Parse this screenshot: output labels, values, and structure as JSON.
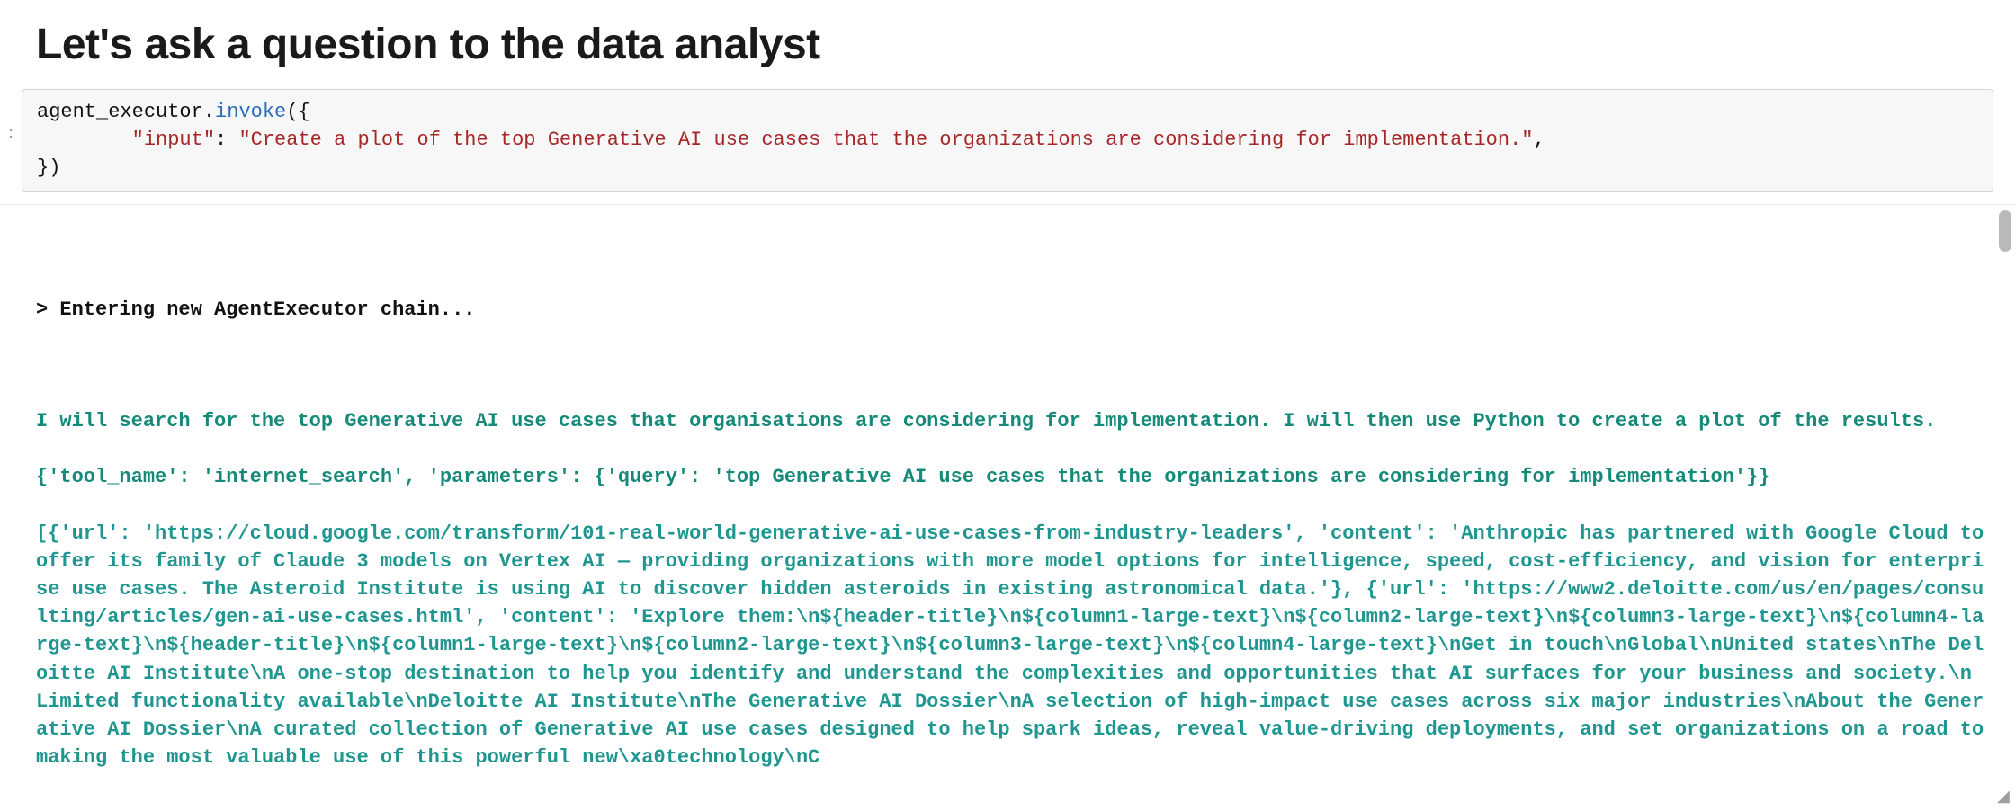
{
  "heading": "Let's ask a question to the data analyst",
  "gutter": ":",
  "code": {
    "line1_obj": "agent_executor",
    "line1_dot": ".",
    "line1_attr": "invoke",
    "line1_open": "({",
    "line2_indent": "        ",
    "line2_key": "\"input\"",
    "line2_colon": ": ",
    "line2_val": "\"Create a plot of the top Generative AI use cases that the organizations are considering for implementation.\"",
    "line2_comma": ",",
    "line3_close": "})"
  },
  "output": {
    "entering": "> Entering new AgentExecutor chain...",
    "thought": "I will search for the top Generative AI use cases that organisations are considering for implementation. I will then use Python to create a plot of the results.",
    "tool_call": "{'tool_name': 'internet_search', 'parameters': {'query': 'top Generative AI use cases that the organizations are considering for implementation'}}",
    "tool_result": "[{'url': 'https://cloud.google.com/transform/101-real-world-generative-ai-use-cases-from-industry-leaders', 'content': 'Anthropic has partnered with Google Cloud to offer its family of Claude 3 models on Vertex AI — providing organizations with more model options for intelligence, speed, cost-efficiency, and vision for enterprise use cases. The Asteroid Institute is using AI to discover hidden asteroids in existing astronomical data.'}, {'url': 'https://www2.deloitte.com/us/en/pages/consulting/articles/gen-ai-use-cases.html', 'content': 'Explore them:\\n${header-title}\\n${column1-large-text}\\n${column2-large-text}\\n${column3-large-text}\\n${column4-large-text}\\n${header-title}\\n${column1-large-text}\\n${column2-large-text}\\n${column3-large-text}\\n${column4-large-text}\\nGet in touch\\nGlobal\\nUnited states\\nThe Deloitte AI Institute\\nA one-stop destination to help you identify and understand the complexities and opportunities that AI surfaces for your business and society.\\n Limited functionality available\\nDeloitte AI Institute\\nThe Generative AI Dossier\\nA selection of high-impact use cases across six major industries\\nAbout the Generative AI Dossier\\nA curated collection of Generative AI use cases designed to help spark ideas, reveal value-driving deployments, and set organizations on a road to making the most valuable use of this powerful new\\xa0technology\\nC"
  }
}
